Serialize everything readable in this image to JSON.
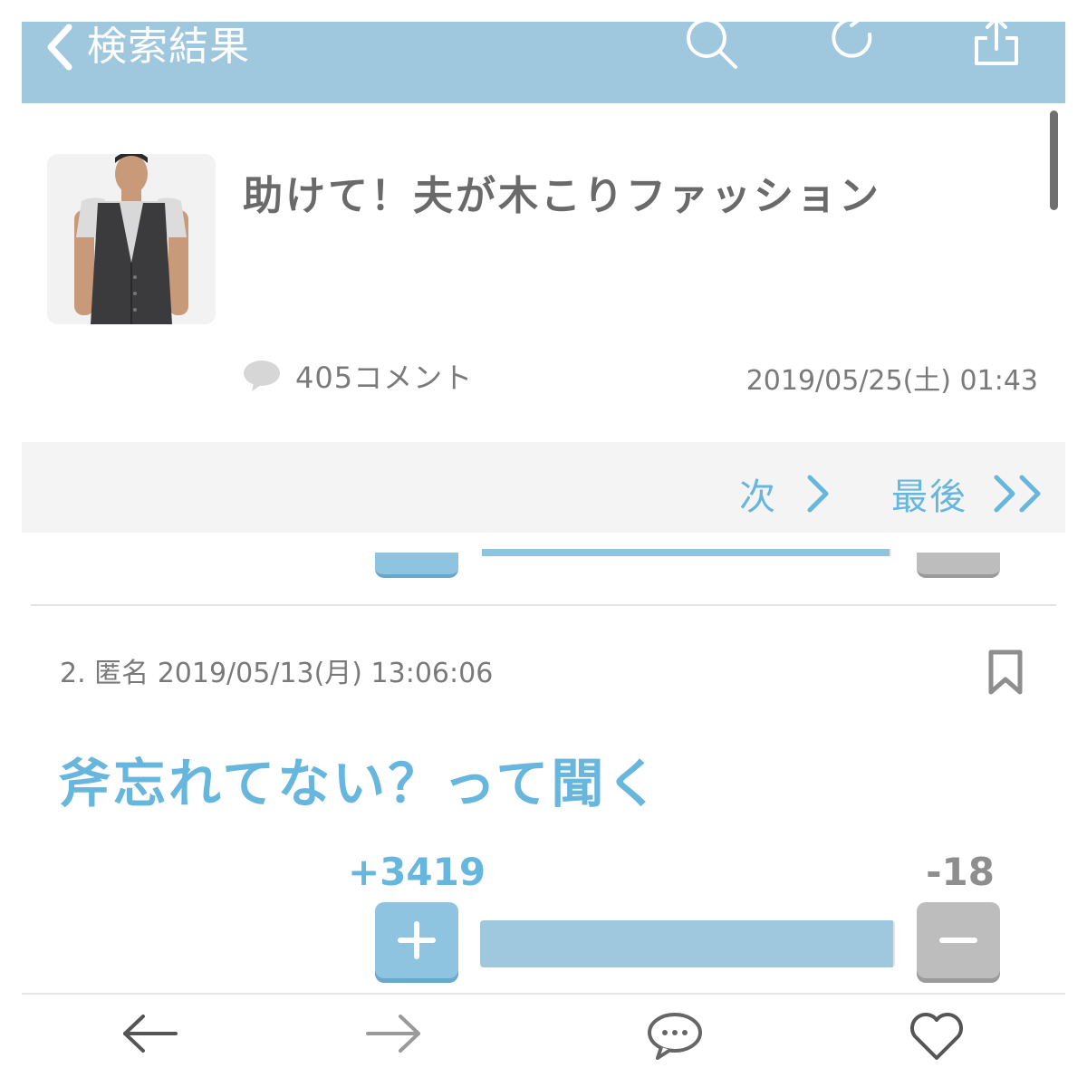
{
  "header": {
    "back_label": "検索結果",
    "bg_color": "#9fc8de"
  },
  "topic": {
    "title": "助けて！夫が木こりファッション",
    "thumbnail": "man-in-vest-photo",
    "comment_count": "405コメント",
    "date": "2019/05/25(土) 01:43"
  },
  "pager": {
    "next_label": "次",
    "last_label": "最後"
  },
  "comment": {
    "meta": "2. 匿名 2019/05/13(月) 13:06:06",
    "body": "斧忘れてない？って聞く",
    "plus_count": "+3419",
    "minus_count": "-18",
    "plus_ratio": 0.995
  },
  "colors": {
    "accent": "#67b6dd",
    "bar": "#9fc8de",
    "muted": "#7a7a7a"
  },
  "toolbar": {
    "icons": [
      "arrow-left-icon",
      "arrow-right-icon",
      "comment-bubble-icon",
      "heart-icon"
    ]
  }
}
